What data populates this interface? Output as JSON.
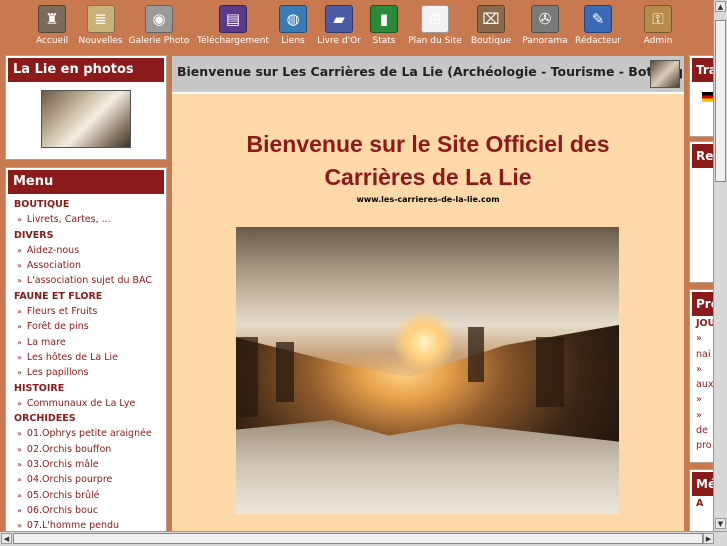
{
  "toolbar": {
    "items": [
      {
        "label": "Accueil",
        "icon": "tower-icon",
        "color": "#7a6a5a",
        "glyph": "♜"
      },
      {
        "label": "Nouvelles",
        "icon": "scroll-icon",
        "color": "#c8b27a",
        "glyph": "≣"
      },
      {
        "label": "Galerie Photo",
        "icon": "camera-icon",
        "color": "#9a9a9a",
        "glyph": "◉"
      },
      {
        "label": "Téléchargement",
        "icon": "floppy-disk-icon",
        "color": "#5a3a8a",
        "glyph": "▤"
      },
      {
        "label": "Liens",
        "icon": "globe-icon",
        "color": "#3a7ab5",
        "glyph": "◍"
      },
      {
        "label": "Livre d'Or",
        "icon": "book-icon",
        "color": "#4a5aa5",
        "glyph": "▰"
      },
      {
        "label": "Stats",
        "icon": "bar-chart-icon",
        "color": "#2a8a3a",
        "glyph": "▮"
      },
      {
        "label": "Plan du Site",
        "icon": "sitemap-icon",
        "color": "#f2f2f2",
        "glyph": "⊞"
      },
      {
        "label": "Boutique",
        "icon": "cash-register-icon",
        "color": "#8a6a4a",
        "glyph": "⌧"
      },
      {
        "label": "Panorama",
        "icon": "film-reel-icon",
        "color": "#7a7a7a",
        "glyph": "✇"
      },
      {
        "label": "Rédacteur",
        "icon": "pen-icon",
        "color": "#3a6ab5",
        "glyph": "✎"
      },
      {
        "label": "Admin",
        "icon": "padlock-icon",
        "color": "#b58a4a",
        "glyph": "⚿"
      }
    ]
  },
  "photo_panel": {
    "title": "La Lie en photos"
  },
  "menu": {
    "title": "Menu",
    "sections": [
      {
        "category": "BOUTIQUE",
        "items": [
          "Livrets, Cartes, ..."
        ]
      },
      {
        "category": "DIVERS",
        "items": [
          "Aidez-nous",
          "Association",
          "L'association sujet du BAC"
        ]
      },
      {
        "category": "FAUNE ET FLORE",
        "items": [
          "Fleurs et Fruits",
          "Forêt de pins",
          "La mare",
          "Les hôtes de La Lie",
          "Les papillons"
        ]
      },
      {
        "category": "HISTOIRE",
        "items": [
          "Communaux de La Lye"
        ]
      },
      {
        "category": "ORCHIDEES",
        "items": [
          "01.Ophrys petite araignée",
          "02.Orchis bouffon",
          "03.Orchis mâle",
          "04.Orchis pourpre",
          "05.Orchis brûlé",
          "06.Orchis bouc",
          "07.L'homme pendu"
        ]
      }
    ]
  },
  "center": {
    "header_title": "Bienvenue sur Les Carrières de La Lie (Archéologie - Tourisme - Botanique)",
    "welcome_line1": "Bienvenue sur le Site Officiel des",
    "welcome_line2": "Carrières de La Lie",
    "url": "www.les-carrieres-de-la-lie.com"
  },
  "right_column": {
    "panel1": {
      "title": "Tra"
    },
    "panel2": {
      "title": "Re"
    },
    "panel3": {
      "title": "Pre",
      "lines": [
        "JOU",
        "»",
        "nai",
        "»",
        "aux",
        "»",
        "»",
        "de",
        "pro"
      ]
    },
    "panel4": {
      "title": "Mé",
      "lines": [
        "A"
      ]
    }
  },
  "colors": {
    "background": "#c9794f",
    "accent": "#8b1a1a",
    "content": "#fdd9a9"
  }
}
